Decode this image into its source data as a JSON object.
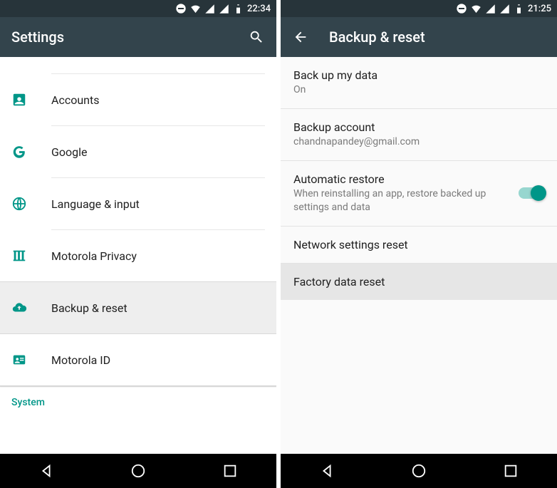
{
  "colors": {
    "accent": "#009688",
    "appbar": "#33444c",
    "status": "#27343a"
  },
  "left": {
    "status_time": "22:34",
    "title": "Settings",
    "items": [
      {
        "label": "Accounts",
        "icon": "account-box-icon"
      },
      {
        "label": "Google",
        "icon": "google-icon"
      },
      {
        "label": "Language & input",
        "icon": "globe-icon"
      },
      {
        "label": "Motorola Privacy",
        "icon": "privacy-icon"
      },
      {
        "label": "Backup & reset",
        "icon": "cloud-upload-icon",
        "selected": true
      },
      {
        "label": "Motorola ID",
        "icon": "id-card-icon"
      }
    ],
    "section_header": "System"
  },
  "right": {
    "status_time": "21:25",
    "title": "Backup & reset",
    "items": [
      {
        "primary": "Back up my data",
        "secondary": "On"
      },
      {
        "primary": "Backup account",
        "secondary": "chandnapandey@gmail.com"
      },
      {
        "primary": "Automatic restore",
        "secondary": "When reinstalling an app, restore backed up settings and data",
        "toggle": true,
        "toggle_on": true
      },
      {
        "primary": "Network settings reset"
      },
      {
        "primary": "Factory data reset",
        "selected": true
      }
    ]
  }
}
